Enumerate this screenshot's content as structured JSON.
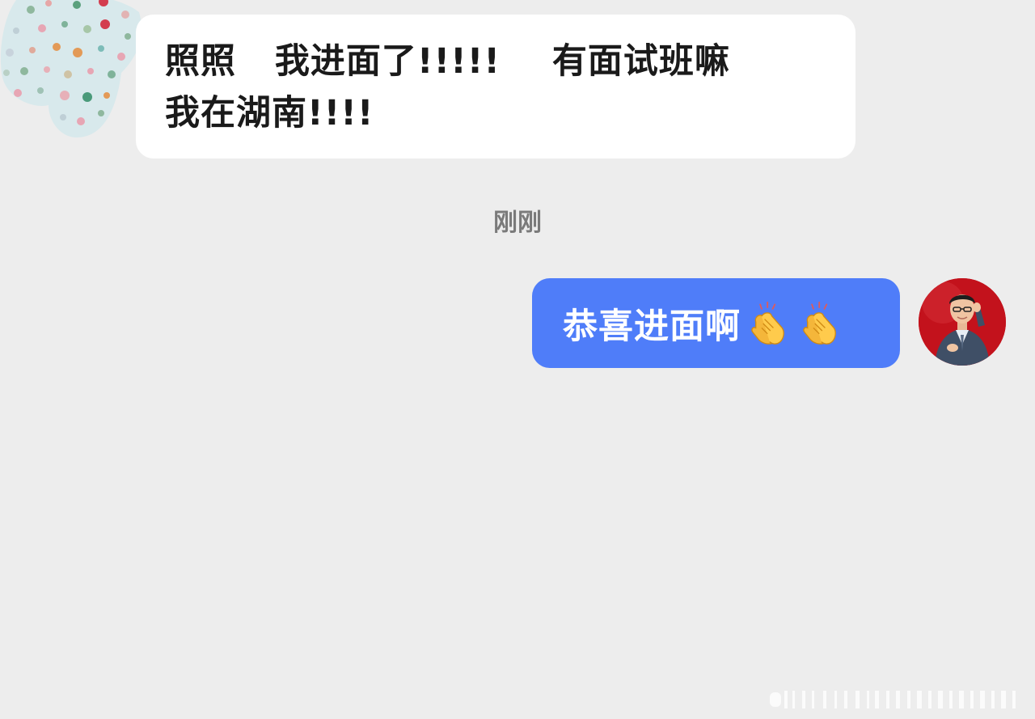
{
  "conversation": {
    "incoming_message": {
      "lines": [
        "照照   我进面了!!!!!    有面试班嘛",
        "我在湖南!!!!"
      ]
    },
    "timestamp": "刚刚",
    "outgoing_message": {
      "text": "恭喜进面啊",
      "emoji": [
        "clapping-hands-icon",
        "clapping-hands-icon"
      ]
    }
  },
  "colors": {
    "background": "#ededed",
    "incoming_bubble": "#ffffff",
    "outgoing_bubble": "#4f7df9",
    "outgoing_avatar_bg": "#c3121c",
    "timestamp_text": "#7a7a7a"
  }
}
